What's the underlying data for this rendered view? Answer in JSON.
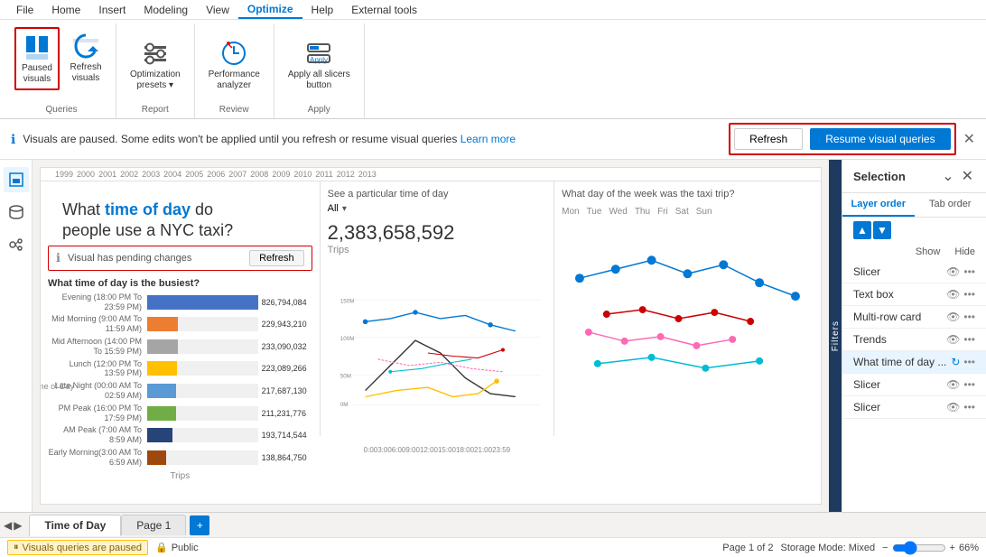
{
  "menu": {
    "items": [
      "File",
      "Home",
      "Insert",
      "Modeling",
      "View",
      "Optimize",
      "Help",
      "External tools"
    ],
    "active": "Optimize"
  },
  "ribbon": {
    "groups": [
      {
        "label": "Queries",
        "buttons": [
          {
            "id": "paused-visuals",
            "label": "Paused\nvisuals",
            "active": true
          },
          {
            "id": "refresh-visuals",
            "label": "Refresh\nvisuals",
            "active": false
          }
        ]
      },
      {
        "label": "Report",
        "buttons": [
          {
            "id": "optimization-presets",
            "label": "Optimization\npresets ▾",
            "active": false
          }
        ]
      },
      {
        "label": "Review",
        "buttons": [
          {
            "id": "performance-analyzer",
            "label": "Performance\nanalyzer",
            "active": false
          }
        ]
      },
      {
        "label": "Apply",
        "buttons": [
          {
            "id": "apply-all-slicers",
            "label": "Apply all slicers\nbutton",
            "active": false
          }
        ]
      }
    ]
  },
  "notification": {
    "text": "Visuals are paused. Some edits won't be applied until you refresh or resume visual queries",
    "link": "Learn more",
    "refresh_btn": "Refresh",
    "resume_btn": "Resume visual queries"
  },
  "refresh_popup": {
    "refresh_btn": "Refresh",
    "resume_btn": "Resume visual queries"
  },
  "canvas": {
    "title_plain": "What ",
    "title_highlight": "time of day",
    "title_rest": " do\npeople use a NYC taxi?",
    "pending_text": "Visual has pending changes",
    "refresh_btn": "Refresh",
    "timeline_years": [
      "1999",
      "2000",
      "2001",
      "2002",
      "2003",
      "2004",
      "2005",
      "2006",
      "2007",
      "2008",
      "2009",
      "2010",
      "2011",
      "2012",
      "2013"
    ],
    "trips_count": "2,383,658,592",
    "trips_label": "Trips",
    "busiest_title": "What time of day is the busiest?",
    "bars": [
      {
        "label": "Evening (18:00 PM To 23:59 PM)",
        "value": 826794084,
        "display": "826,794,084",
        "pct": 100,
        "color": "#4472c4"
      },
      {
        "label": "Mid Morning (9:00 AM To 11:59 AM)",
        "value": 229943210,
        "display": "229,943,210",
        "pct": 28,
        "color": "#ed7d31"
      },
      {
        "label": "Mid Afternoon (14:00 PM To 15:59 PM)",
        "value": 233090032,
        "display": "233,090,032",
        "pct": 28,
        "color": "#a5a5a5"
      },
      {
        "label": "Lunch (12:00 PM To 13:59 PM)",
        "value": 223089266,
        "display": "223,089,266",
        "pct": 27,
        "color": "#ffc000"
      },
      {
        "label": "Late Night (00:00 AM To 02:59 AM)",
        "value": 217687130,
        "display": "217,687,130",
        "pct": 26,
        "color": "#5b9bd5"
      },
      {
        "label": "PM Peak (16:00 PM To 17:59 PM)",
        "value": 211231776,
        "display": "211,231,776",
        "pct": 26,
        "color": "#70ad47"
      },
      {
        "label": "AM Peak (7:00 AM To 8:59 AM)",
        "value": 193714544,
        "display": "193,714,544",
        "pct": 23,
        "color": "#264478"
      },
      {
        "label": "Early Morning(3:00 AM To 6:59 AM)",
        "value": 138864750,
        "display": "138,864,750",
        "pct": 17,
        "color": "#9e480e"
      }
    ],
    "center_subtitle": "See a particular time of day",
    "center_filter": "All",
    "right_subtitle": "What day of the week was the taxi trip?",
    "day_labels": [
      "Mon",
      "Tue",
      "Wed",
      "Thu",
      "Fri",
      "Sat",
      "Sun"
    ]
  },
  "selection_panel": {
    "title": "Selection",
    "tabs": [
      "Layer order",
      "Tab order"
    ],
    "show_label": "Show",
    "hide_label": "Hide",
    "layers": [
      {
        "name": "Slicer",
        "visible": true,
        "highlighted": false
      },
      {
        "name": "Text box",
        "visible": true,
        "highlighted": false
      },
      {
        "name": "Multi-row card",
        "visible": true,
        "highlighted": false
      },
      {
        "name": "Trends",
        "visible": true,
        "highlighted": false
      },
      {
        "name": "What time of day ...",
        "visible": true,
        "highlighted": true
      },
      {
        "name": "Slicer",
        "visible": true,
        "highlighted": false
      },
      {
        "name": "Slicer",
        "visible": true,
        "highlighted": false
      }
    ]
  },
  "page_tabs": {
    "tabs": [
      "Time of Day",
      "Page 1"
    ],
    "active": "Time of Day",
    "page_count": "Page 1 of 2"
  },
  "status_bar": {
    "paused_text": "Visuals queries are paused",
    "public_text": "Public",
    "storage_mode": "Storage Mode: Mixed",
    "zoom": "66%"
  }
}
